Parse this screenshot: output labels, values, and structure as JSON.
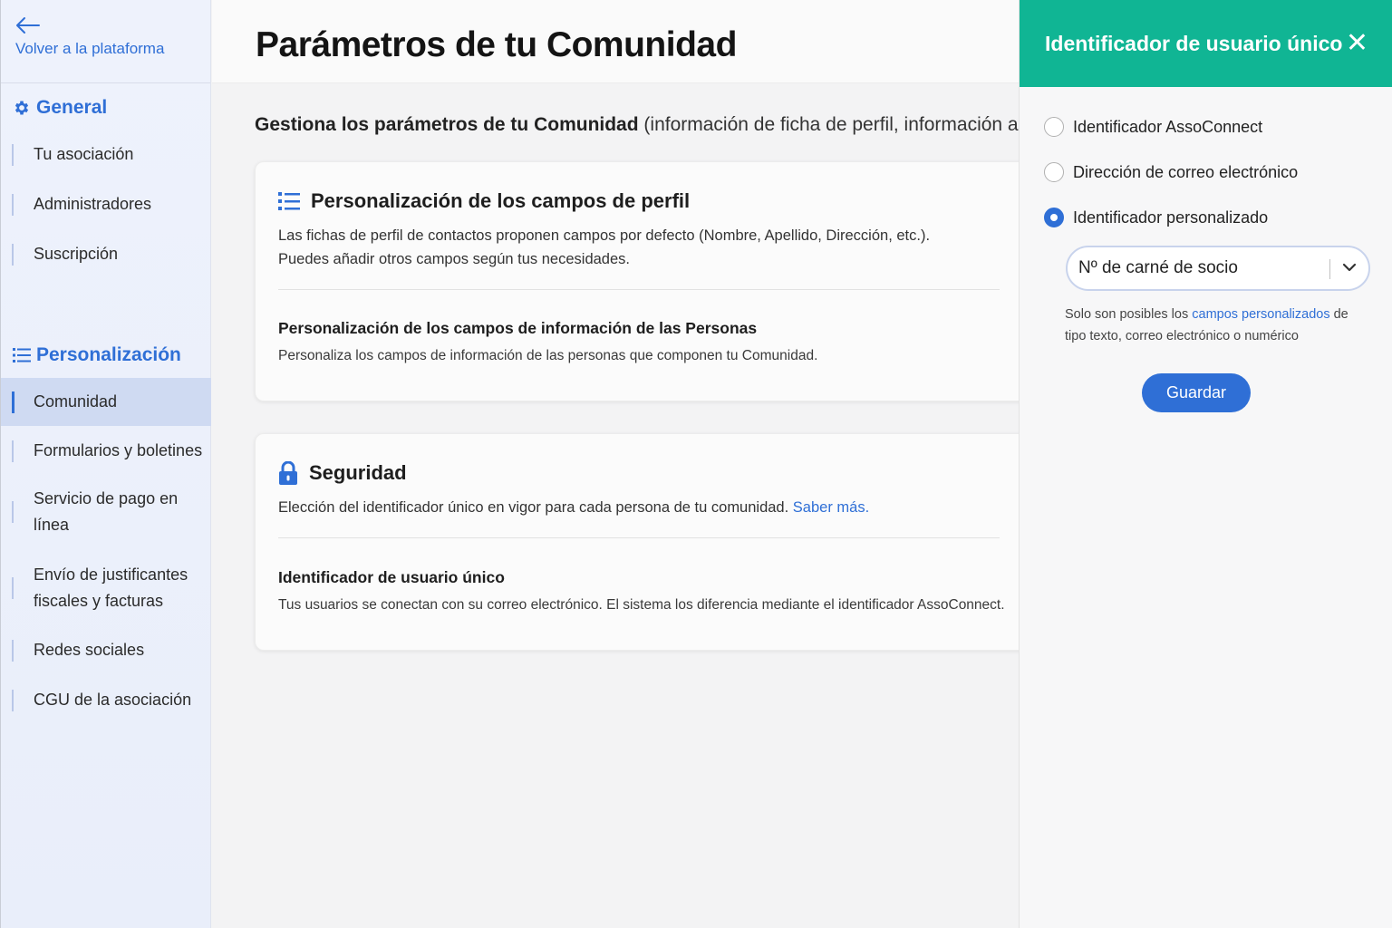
{
  "sidebar": {
    "back_label": "Volver a la plataforma",
    "general_title": "General",
    "general_items": [
      {
        "label": "Tu asociación"
      },
      {
        "label": "Administradores"
      },
      {
        "label": "Suscripción"
      }
    ],
    "personalization_title": "Personalización",
    "personalization_items": [
      {
        "label": "Comunidad",
        "active": true
      },
      {
        "label": "Formularios y boletines"
      },
      {
        "label": "Servicio de pago en línea"
      },
      {
        "label": "Envío de justificantes fiscales y facturas"
      },
      {
        "label": "Redes sociales"
      },
      {
        "label": "CGU de la asociación"
      }
    ]
  },
  "main": {
    "title": "Parámetros de tu Comunidad",
    "subtitle_bold": "Gestiona los parámetros de tu Comunidad",
    "subtitle_rest": " (información de ficha de perfil, información a la con",
    "card_profile": {
      "title": "Personalización de los campos de perfil",
      "desc_line1": "Las fichas de perfil de contactos proponen campos por defecto (Nombre, Apellido, Dirección, etc.).",
      "desc_line2": "Puedes añadir otros campos según tus necesidades.",
      "sub_title": "Personalización de los campos de información de las Personas",
      "sub_desc": "Personaliza los campos de información de las personas que componen tu Comunidad."
    },
    "card_security": {
      "title": "Seguridad",
      "desc": "Elección del identificador único en vigor para cada persona de tu comunidad. ",
      "link": "Saber más.",
      "sub_title": "Identificador de usuario único",
      "sub_desc": "Tus usuarios se conectan con su correo electrónico. El sistema los diferencia mediante el identificador AssoConnect."
    }
  },
  "panel": {
    "title": "Identificador de usuario único",
    "close": "✕",
    "options": [
      {
        "label": "Identificador AssoConnect",
        "checked": false
      },
      {
        "label": "Dirección de correo electrónico",
        "checked": false
      },
      {
        "label": "Identificador personalizado",
        "checked": true
      }
    ],
    "select_value": "Nº de carné de socio",
    "info_before": "Solo son posibles los ",
    "info_link": "campos personalizados",
    "info_after": " de tipo texto, correo electrónico o numérico",
    "save_label": "Guardar"
  },
  "colors": {
    "accent": "#2f6fd6",
    "panel_header": "#10b594",
    "active_nav": "#cfdaf2"
  }
}
